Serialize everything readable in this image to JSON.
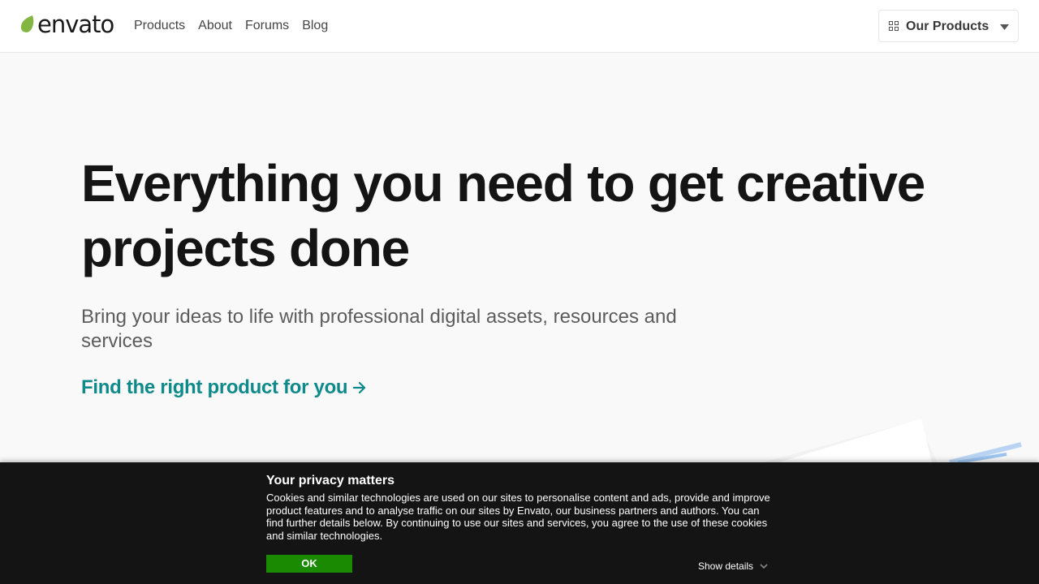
{
  "brand": {
    "logo_text": "envato",
    "leaf_color": "#82b541"
  },
  "nav": {
    "items": [
      {
        "label": "Products"
      },
      {
        "label": "About"
      },
      {
        "label": "Forums"
      },
      {
        "label": "Blog"
      }
    ]
  },
  "header": {
    "our_products_label": "Our Products",
    "grid_icon": "grid-icon",
    "caret_icon": "caret-down-icon"
  },
  "hero": {
    "title": "Everything you need to get creative projects done",
    "subtitle": "Bring your ideas to life with professional digital assets, resources and services",
    "cta_label": "Find the right product for you",
    "cta_icon": "arrow-right-icon",
    "cta_color": "#0f8a8a"
  },
  "cookie_banner": {
    "title": "Your privacy matters",
    "body": "Cookies and similar technologies are used on our sites to personalise content and ads, provide and improve product features and to analyse traffic on our sites by Envato, our business partners and authors. You can find further details below. By continuing to use our sites and services, you agree to the use of these cookies and similar technologies.",
    "ok_label": "OK",
    "ok_color": "#1a8a02",
    "show_details_label": "Show details",
    "show_details_icon": "chevron-down-icon"
  }
}
